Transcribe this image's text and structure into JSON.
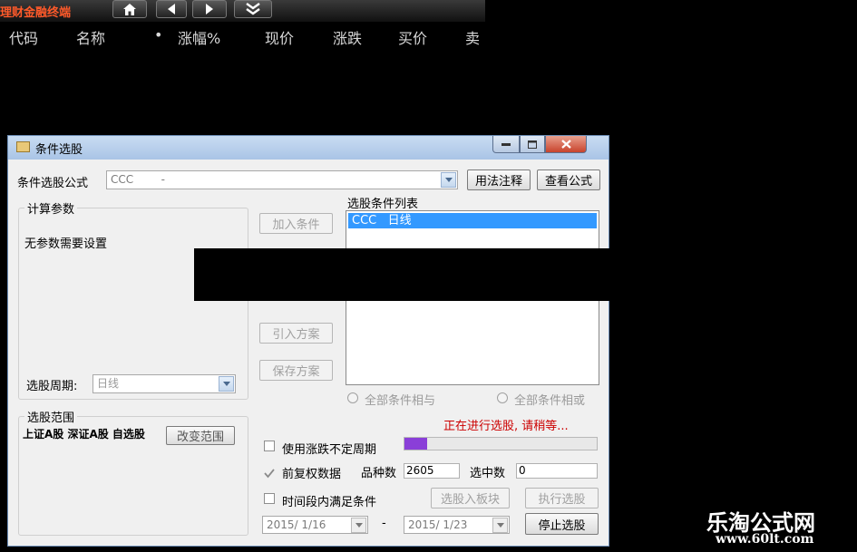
{
  "app": {
    "title": "理财金融终端",
    "nav": [
      "home-icon",
      "arrow-left-icon",
      "arrow-right-icon",
      "double-chevron-down-icon"
    ]
  },
  "columns": [
    "代码",
    "名称",
    "•",
    "涨幅%",
    "现价",
    "涨跌",
    "买价",
    "卖"
  ],
  "dialog": {
    "title": "条件选股",
    "formula_label": "条件选股公式",
    "formula_value": "CCC        -",
    "usage_button": "用法注释",
    "view_button": "查看公式",
    "params_title": "计算参数",
    "params_text": "无参数需要设置",
    "period_label": "选股周期:",
    "period_value": "日线",
    "scope_title": "选股范围",
    "scope_text": "上证A股 深证A股 自选股",
    "change_scope_button": "改变范围",
    "add_condition_button": "加入条件",
    "import_scheme_button": "引入方案",
    "save_scheme_button": "保存方案",
    "list_title": "选股条件列表",
    "list_items": [
      "CCC   日线"
    ],
    "radio_and": "全部条件相与",
    "radio_or": "全部条件相或",
    "status_text": "正在进行选股, 请稍等...",
    "progress": 0.12,
    "use_uncertain_period": "使用涨跌不定周期",
    "adjusted_data": "前复权数据",
    "variety_label": "品种数",
    "variety_value": "2605",
    "selected_label": "选中数",
    "selected_value": "0",
    "time_range_label": "时间段内满足条件",
    "to_block_button": "选股入板块",
    "execute_button": "执行选股",
    "date_from": "2015/ 1/16",
    "date_sep": "-",
    "date_to": "2015/ 1/23",
    "stop_button": "停止选股"
  },
  "watermark": {
    "name": "乐淘公式网",
    "url": "www.60lt.com"
  },
  "colors": {
    "background": "#000000",
    "title_accent": "#ff5a2a",
    "selection": "#3399ff",
    "status_red": "#cc0000",
    "progress_fill": "#8a3fd8"
  }
}
